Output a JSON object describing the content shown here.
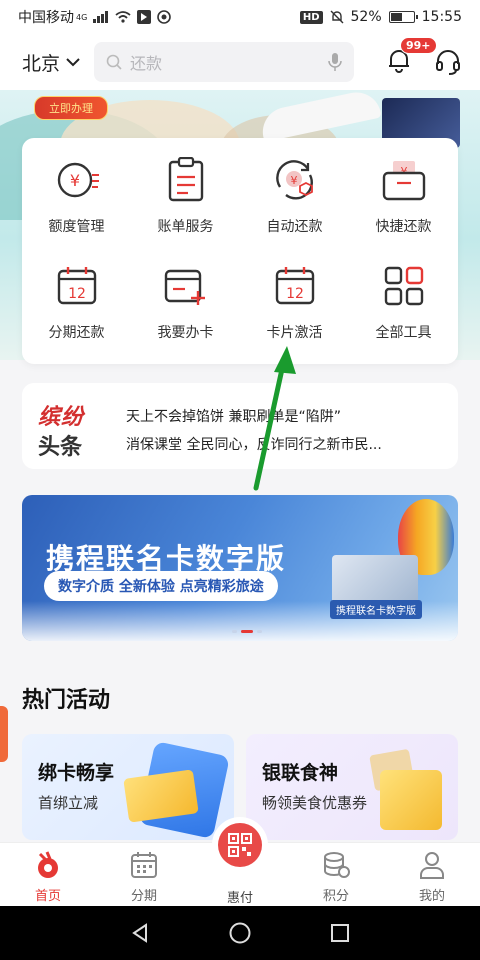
{
  "status_bar": {
    "carrier": "中国移动",
    "network": "4G",
    "hd": "HD",
    "battery": "52%",
    "battery_level": 0.52,
    "time": "15:55"
  },
  "header": {
    "city": "北京",
    "search_placeholder": "还款",
    "notification_badge": "99+"
  },
  "hero_banner": {
    "tag": "立即办理"
  },
  "quick_menu": {
    "items": [
      {
        "label": "额度管理",
        "icon": "credit-limit-icon"
      },
      {
        "label": "账单服务",
        "icon": "bill-icon"
      },
      {
        "label": "自动还款",
        "icon": "auto-repay-icon"
      },
      {
        "label": "快捷还款",
        "icon": "quick-repay-icon"
      },
      {
        "label": "分期还款",
        "icon": "installment-calendar-icon"
      },
      {
        "label": "我要办卡",
        "icon": "apply-card-icon"
      },
      {
        "label": "卡片激活",
        "icon": "card-activate-calendar-icon"
      },
      {
        "label": "全部工具",
        "icon": "all-tools-grid-icon"
      }
    ]
  },
  "news": {
    "logo_line1": "缤纷",
    "logo_line2": "头条",
    "line1": "天上不会掉馅饼 兼职刷单是“陷阱”",
    "line2": "消保课堂  全民同心，反诈同行之新市民..."
  },
  "promo_banner": {
    "title": "携程联名卡数字版",
    "subtitle": "数字介质 全新体验 点亮精彩旅途",
    "card_caption": "携程联名卡数字版"
  },
  "hot_activities": {
    "title": "热门活动",
    "cards": [
      {
        "title": "绑卡畅享",
        "subtitle": "首绑立减"
      },
      {
        "title": "银联食神",
        "subtitle": "畅领美食优惠券"
      }
    ]
  },
  "tab_bar": {
    "tabs": [
      {
        "label": "首页",
        "icon": "home-icon",
        "active": true
      },
      {
        "label": "分期",
        "icon": "calendar-icon",
        "active": false
      },
      {
        "label": "惠付",
        "icon": "qr-pay-icon",
        "active": false
      },
      {
        "label": "积分",
        "icon": "points-coins-icon",
        "active": false
      },
      {
        "label": "我的",
        "icon": "profile-icon",
        "active": false
      }
    ]
  },
  "colors": {
    "accent": "#e53935",
    "arrow": "#1a9b2e"
  }
}
